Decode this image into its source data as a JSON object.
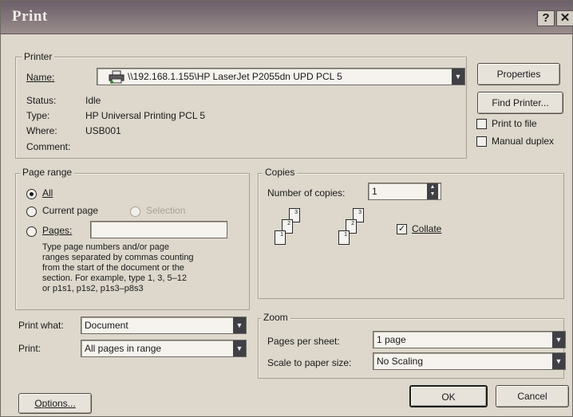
{
  "window": {
    "title": "Print",
    "help_glyph": "?",
    "close_glyph": "✕"
  },
  "printer": {
    "legend": "Printer",
    "name_label": "Name:",
    "name_value": "\\\\192.168.1.155\\HP LaserJet P2055dn UPD PCL 5",
    "status_label": "Status:",
    "status_value": "Idle",
    "type_label": "Type:",
    "type_value": "HP Universal Printing PCL 5",
    "where_label": "Where:",
    "where_value": "USB001",
    "comment_label": "Comment:",
    "comment_value": "",
    "properties_label": "Properties",
    "find_printer_label": "Find Printer...",
    "print_to_file_label": "Print to file",
    "print_to_file_checked": false,
    "manual_duplex_label": "Manual duplex",
    "manual_duplex_checked": false
  },
  "page_range": {
    "legend": "Page range",
    "all_label": "All",
    "current_page_label": "Current page",
    "selection_label": "Selection",
    "pages_label": "Pages:",
    "pages_value": "",
    "selected": "all",
    "help_lines": [
      "Type page numbers and/or page",
      "ranges separated by commas counting",
      "from the start of the document or the",
      "section. For example, type 1, 3, 5–12",
      "or p1s1, p1s2, p1s3–p8s3"
    ]
  },
  "copies": {
    "legend": "Copies",
    "number_label": "Number of copies:",
    "number_value": "1",
    "collate_label": "Collate",
    "collate_checked": true
  },
  "print_what": {
    "label": "Print what:",
    "value": "Document"
  },
  "print": {
    "label": "Print:",
    "value": "All pages in range"
  },
  "zoom": {
    "legend": "Zoom",
    "pages_per_sheet_label": "Pages per sheet:",
    "pages_per_sheet_value": "1 page",
    "scale_label": "Scale to paper size:",
    "scale_value": "No Scaling"
  },
  "footer": {
    "options_label": "Options...",
    "ok_label": "OK",
    "cancel_label": "Cancel"
  },
  "icons": {
    "printer": "printer-icon",
    "dropdown": "▼",
    "spin_up": "▲",
    "spin_down": "▼",
    "check": "✓"
  }
}
